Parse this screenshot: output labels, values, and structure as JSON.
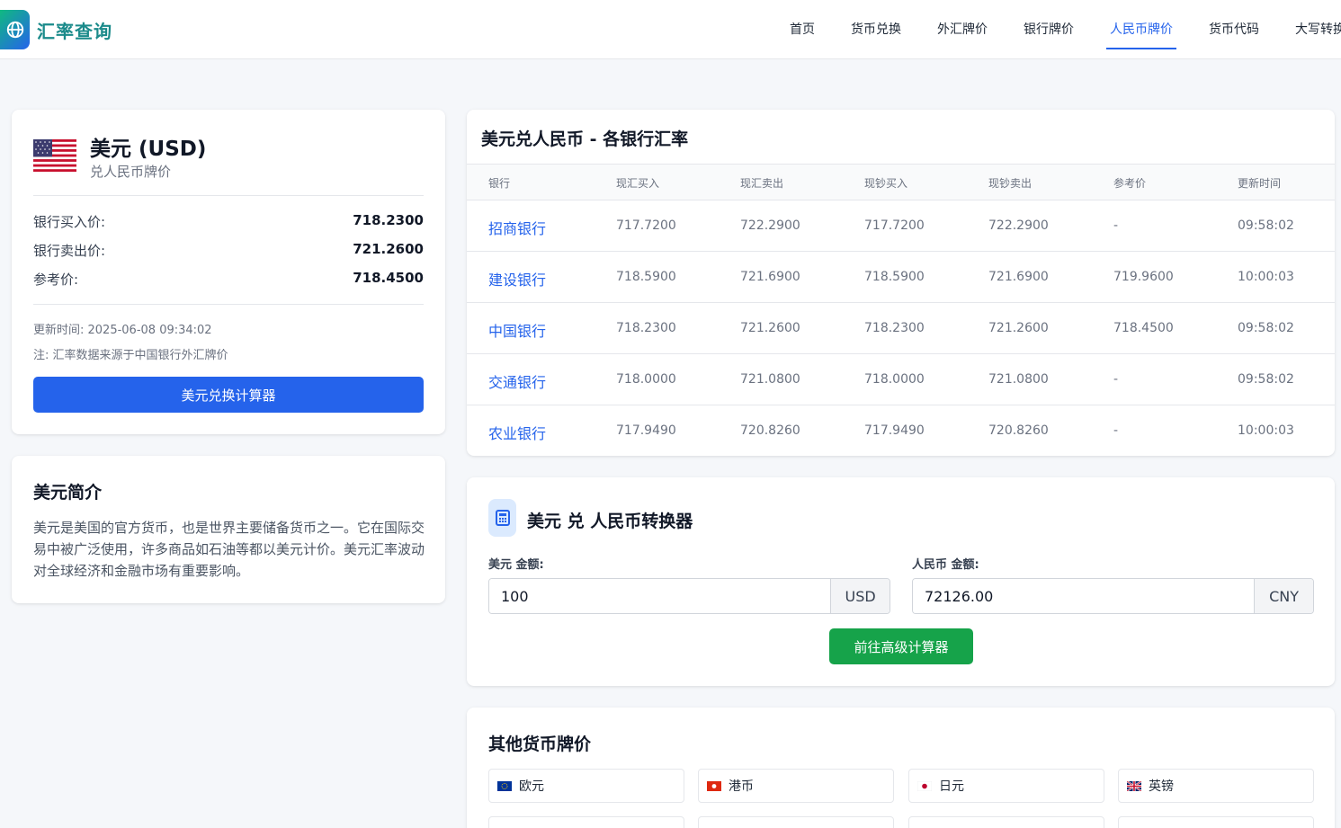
{
  "brand": {
    "name": "汇率查询"
  },
  "nav": [
    {
      "label": "首页"
    },
    {
      "label": "货币兑换"
    },
    {
      "label": "外汇牌价"
    },
    {
      "label": "银行牌价"
    },
    {
      "label": "人民币牌价",
      "active": true
    },
    {
      "label": "货币代码"
    },
    {
      "label": "大写转换"
    }
  ],
  "currency_card": {
    "title": "美元 (USD)",
    "subtitle": "兑人民币牌价",
    "rates": [
      {
        "label": "银行买入价:",
        "value": "718.2300"
      },
      {
        "label": "银行卖出价:",
        "value": "721.2600"
      },
      {
        "label": "参考价:",
        "value": "718.4500"
      }
    ],
    "updated": "更新时间: 2025-06-08 09:34:02",
    "note": "注: 汇率数据来源于中国银行外汇牌价",
    "calc_button": "美元兑换计算器"
  },
  "intro": {
    "title": "美元简介",
    "text": "美元是美国的官方货币，也是世界主要储备货币之一。它在国际交易中被广泛使用，许多商品如石油等都以美元计价。美元汇率波动对全球经济和金融市场有重要影响。"
  },
  "bank_table": {
    "title": "美元兑人民币 - 各银行汇率",
    "headers": [
      "银行",
      "现汇买入",
      "现汇卖出",
      "现钞买入",
      "现钞卖出",
      "参考价",
      "更新时间"
    ],
    "rows": [
      [
        "招商银行",
        "717.7200",
        "722.2900",
        "717.7200",
        "722.2900",
        "-",
        "09:58:02"
      ],
      [
        "建设银行",
        "718.5900",
        "721.6900",
        "718.5900",
        "721.6900",
        "719.9600",
        "10:00:03"
      ],
      [
        "中国银行",
        "718.2300",
        "721.2600",
        "718.2300",
        "721.2600",
        "718.4500",
        "09:58:02"
      ],
      [
        "交通银行",
        "718.0000",
        "721.0800",
        "718.0000",
        "721.0800",
        "-",
        "09:58:02"
      ],
      [
        "农业银行",
        "717.9490",
        "720.8260",
        "717.9490",
        "720.8260",
        "-",
        "10:00:03"
      ]
    ]
  },
  "converter": {
    "title": "美元 兑 人民币转换器",
    "from_label": "美元 金额:",
    "from_value": "100",
    "from_code": "USD",
    "to_label": "人民币 金额:",
    "to_value": "72126.00",
    "to_code": "CNY",
    "advanced_button": "前往高级计算器"
  },
  "other_currencies": {
    "title": "其他货币牌价",
    "items": [
      {
        "label": "欧元",
        "flag": "eu-flag-icon"
      },
      {
        "label": "港币",
        "flag": "hk-flag-icon"
      },
      {
        "label": "日元",
        "flag": "jp-flag-icon"
      },
      {
        "label": "英镑",
        "flag": "gb-flag-icon"
      }
    ]
  },
  "colors": {
    "primary": "#2563eb",
    "success": "#16a34a",
    "brand_text": "#1a8a8a"
  }
}
